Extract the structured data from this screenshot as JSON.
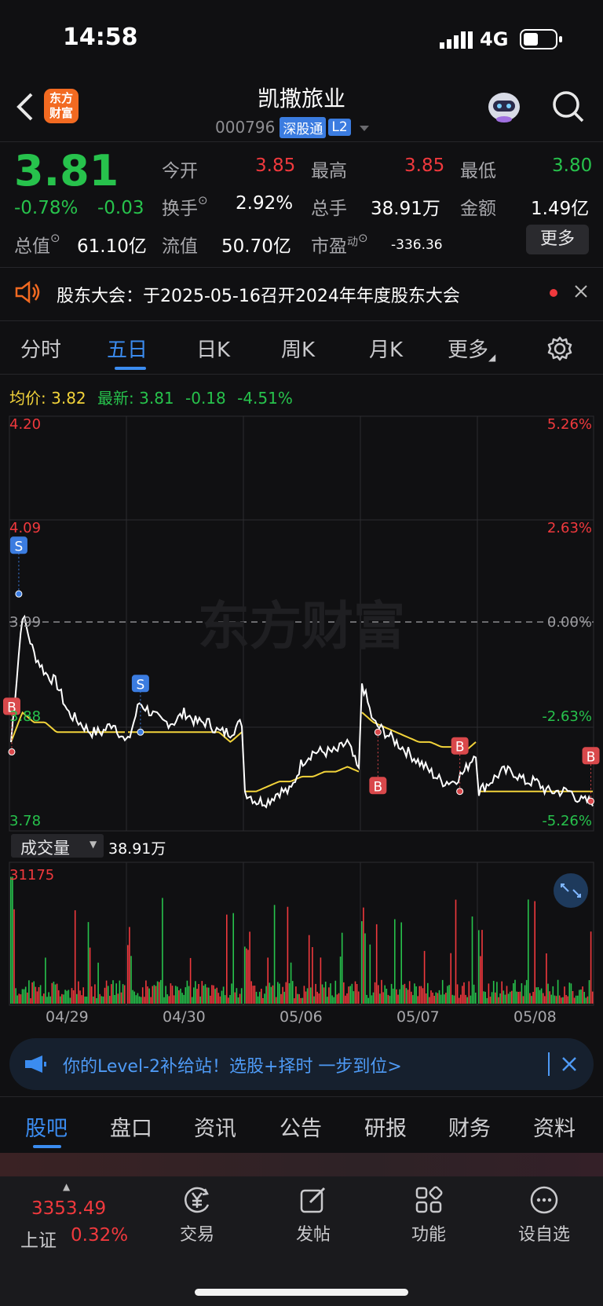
{
  "status_bar": {
    "time": "14:58",
    "network": "4G"
  },
  "header": {
    "logo_text": "东方财富",
    "title": "凯撒旅业",
    "code": "000796",
    "badge": "深股通",
    "level": "L2"
  },
  "quote": {
    "price": "3.81",
    "change_pct": "-0.78%",
    "change": "-0.03",
    "open_label": "今开",
    "open_value": "3.85",
    "high_label": "最高",
    "high_value": "3.85",
    "low_label": "最低",
    "low_value": "3.80",
    "turnover_label": "换手",
    "turnover_value": "2.92%",
    "volume_label": "总手",
    "volume_value": "38.91万",
    "amount_label": "金额",
    "amount_value": "1.49亿",
    "mcap_label": "总值",
    "mcap_value": "61.10亿",
    "float_label": "流值",
    "float_value": "50.70亿",
    "pe_label": "市盈",
    "pe_sup": "动",
    "pe_value": "-336.36",
    "more_button": "更多"
  },
  "notice": {
    "text": "股东大会：于2025-05-16召开2024年年度股东大会"
  },
  "chart_tabs": [
    {
      "label": "分时"
    },
    {
      "label": "五日"
    },
    {
      "label": "日K"
    },
    {
      "label": "周K"
    },
    {
      "label": "月K"
    },
    {
      "label": "更多"
    }
  ],
  "chart_legend": {
    "avg_label": "均价:",
    "avg_value": "3.82",
    "latest_label": "最新:",
    "latest_value": "3.81",
    "latest_change": "-0.18",
    "latest_pct": "-4.51%"
  },
  "chart_labels": {
    "p1": "4.20",
    "p2": "4.09",
    "p3": "3.99",
    "p4": "3.88",
    "p5": "3.78",
    "r1": "5.26%",
    "r2": "2.63%",
    "r3": "0.00%",
    "r4": "-2.63%",
    "r5": "-5.26%",
    "watermark": "东方财富",
    "marker_s": "S",
    "marker_b": "B"
  },
  "volume_panel": {
    "selector_label": "成交量",
    "total": "38.91万",
    "max_label": "31175"
  },
  "dates": [
    "04/29",
    "04/30",
    "05/06",
    "05/07",
    "05/08"
  ],
  "chart_data": {
    "type": "line",
    "x": [
      "04/29",
      "04/30",
      "05/06",
      "05/07",
      "05/08"
    ],
    "ylim": [
      3.78,
      4.2
    ],
    "pct_range": [
      "-5.26%",
      "5.26%"
    ],
    "prev_close": 3.99,
    "series": [
      {
        "name": "最新",
        "color": "#ffffff",
        "values": [
          3.87,
          3.89,
          3.84,
          3.86,
          3.81
        ]
      },
      {
        "name": "均价",
        "color": "#f2d33a",
        "values": [
          3.88,
          3.88,
          3.84,
          3.87,
          3.82
        ]
      }
    ],
    "volume_max": 31175,
    "markers": [
      {
        "type": "S",
        "day": "04/29",
        "price": 4.02
      },
      {
        "type": "S",
        "day": "04/30",
        "price": 3.88
      },
      {
        "type": "B",
        "day": "04/29",
        "price": 3.86
      },
      {
        "type": "B",
        "day": "05/07",
        "price": 3.88
      },
      {
        "type": "B",
        "day": "05/07",
        "price": 3.82
      },
      {
        "type": "B",
        "day": "05/08",
        "price": 3.81
      }
    ]
  },
  "promo": {
    "text": "你的Level-2补给站！选股+择时 一步到位>"
  },
  "bottom_tabs": [
    {
      "label": "股吧"
    },
    {
      "label": "盘口"
    },
    {
      "label": "资讯"
    },
    {
      "label": "公告"
    },
    {
      "label": "研报"
    },
    {
      "label": "财务"
    },
    {
      "label": "资料"
    }
  ],
  "bottom_nav": {
    "index_value": "3353.49",
    "index_name": "上证",
    "index_pct": "0.32%",
    "trade": "交易",
    "post": "发帖",
    "func": "功能",
    "watch": "设自选"
  },
  "colors": {
    "up": "#f0393d",
    "down": "#27c24c",
    "avg": "#f2d33a",
    "accent": "#3b8cf0"
  }
}
